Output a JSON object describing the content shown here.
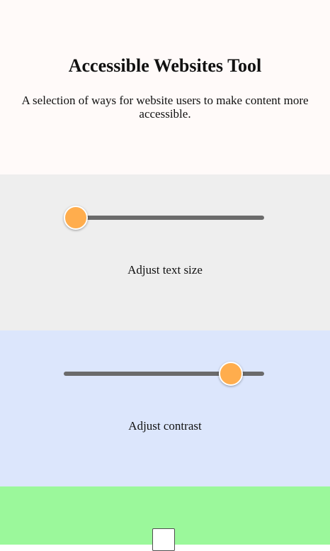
{
  "header": {
    "title": "Accessible Websites Tool",
    "subtitle": "A selection of ways for website users to make content more accessible."
  },
  "text_size": {
    "label": "Adjust text size",
    "value": 0,
    "min": 0,
    "max": 1,
    "background": "#eeeeee"
  },
  "contrast": {
    "label": "Adjust contrast",
    "value": 0.88,
    "min": 0,
    "max": 1,
    "background": "#dce6fc"
  },
  "toggle_panel": {
    "checked": false,
    "background": "#9bf89b"
  },
  "colors": {
    "accent": "#ffad4d",
    "track": "#6b6b6b"
  }
}
